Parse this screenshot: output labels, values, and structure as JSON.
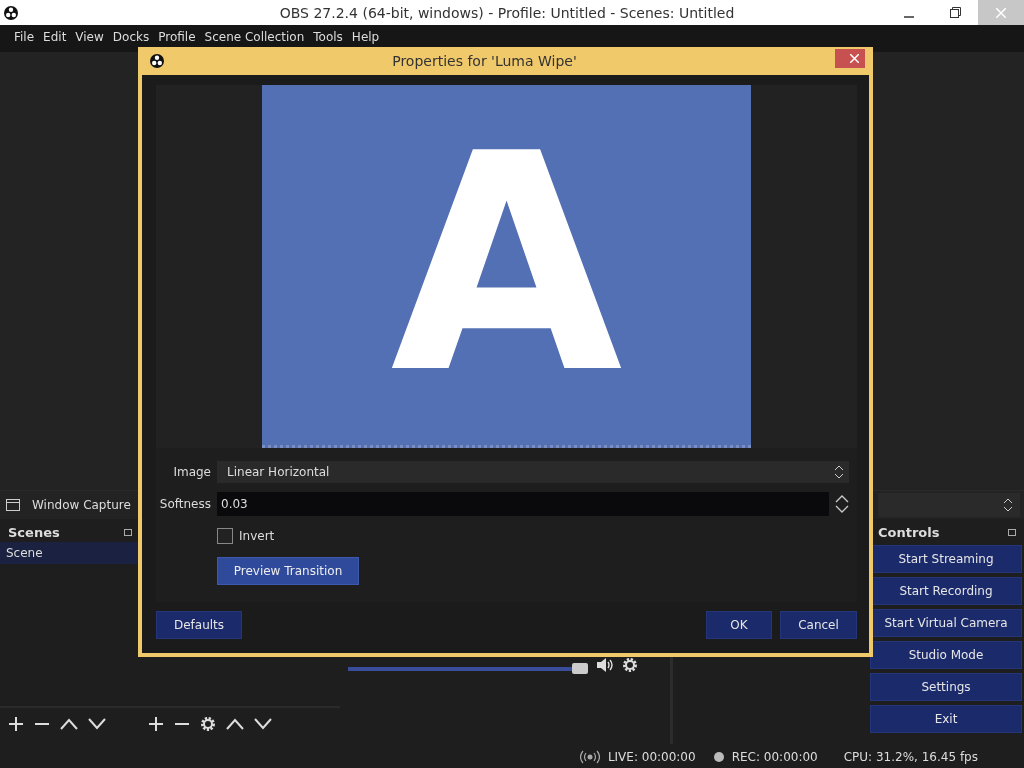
{
  "window": {
    "title": "OBS 27.2.4 (64-bit, windows) - Profile: Untitled - Scenes: Untitled"
  },
  "menu": [
    "File",
    "Edit",
    "View",
    "Docks",
    "Profile",
    "Scene Collection",
    "Tools",
    "Help"
  ],
  "source_bar": {
    "source": "Window Capture"
  },
  "scenes": {
    "title": "Scenes",
    "items": [
      {
        "label": "Scene",
        "selected": true
      }
    ]
  },
  "mixer": {
    "level": 1
  },
  "controls": {
    "title": "Controls",
    "buttons": [
      "Start Streaming",
      "Start Recording",
      "Start Virtual Camera",
      "Studio Mode",
      "Settings",
      "Exit"
    ]
  },
  "status": {
    "live": "LIVE: 00:00:00",
    "rec": "REC: 00:00:00",
    "cpu": "CPU: 31.2%, 16.45 fps"
  },
  "dialog": {
    "title": "Properties for 'Luma Wipe'",
    "preview": {
      "letter": "A"
    },
    "fields": [
      {
        "kind": "select",
        "label": "Image",
        "value": "Linear Horizontal"
      },
      {
        "kind": "spin",
        "label": "Softness",
        "value": "0.03"
      },
      {
        "kind": "checkbox",
        "label": "Invert",
        "checked": false
      },
      {
        "kind": "button",
        "label": "Preview Transition"
      }
    ],
    "buttons_left": [
      "Defaults"
    ],
    "buttons_right": [
      "OK",
      "Cancel"
    ]
  }
}
